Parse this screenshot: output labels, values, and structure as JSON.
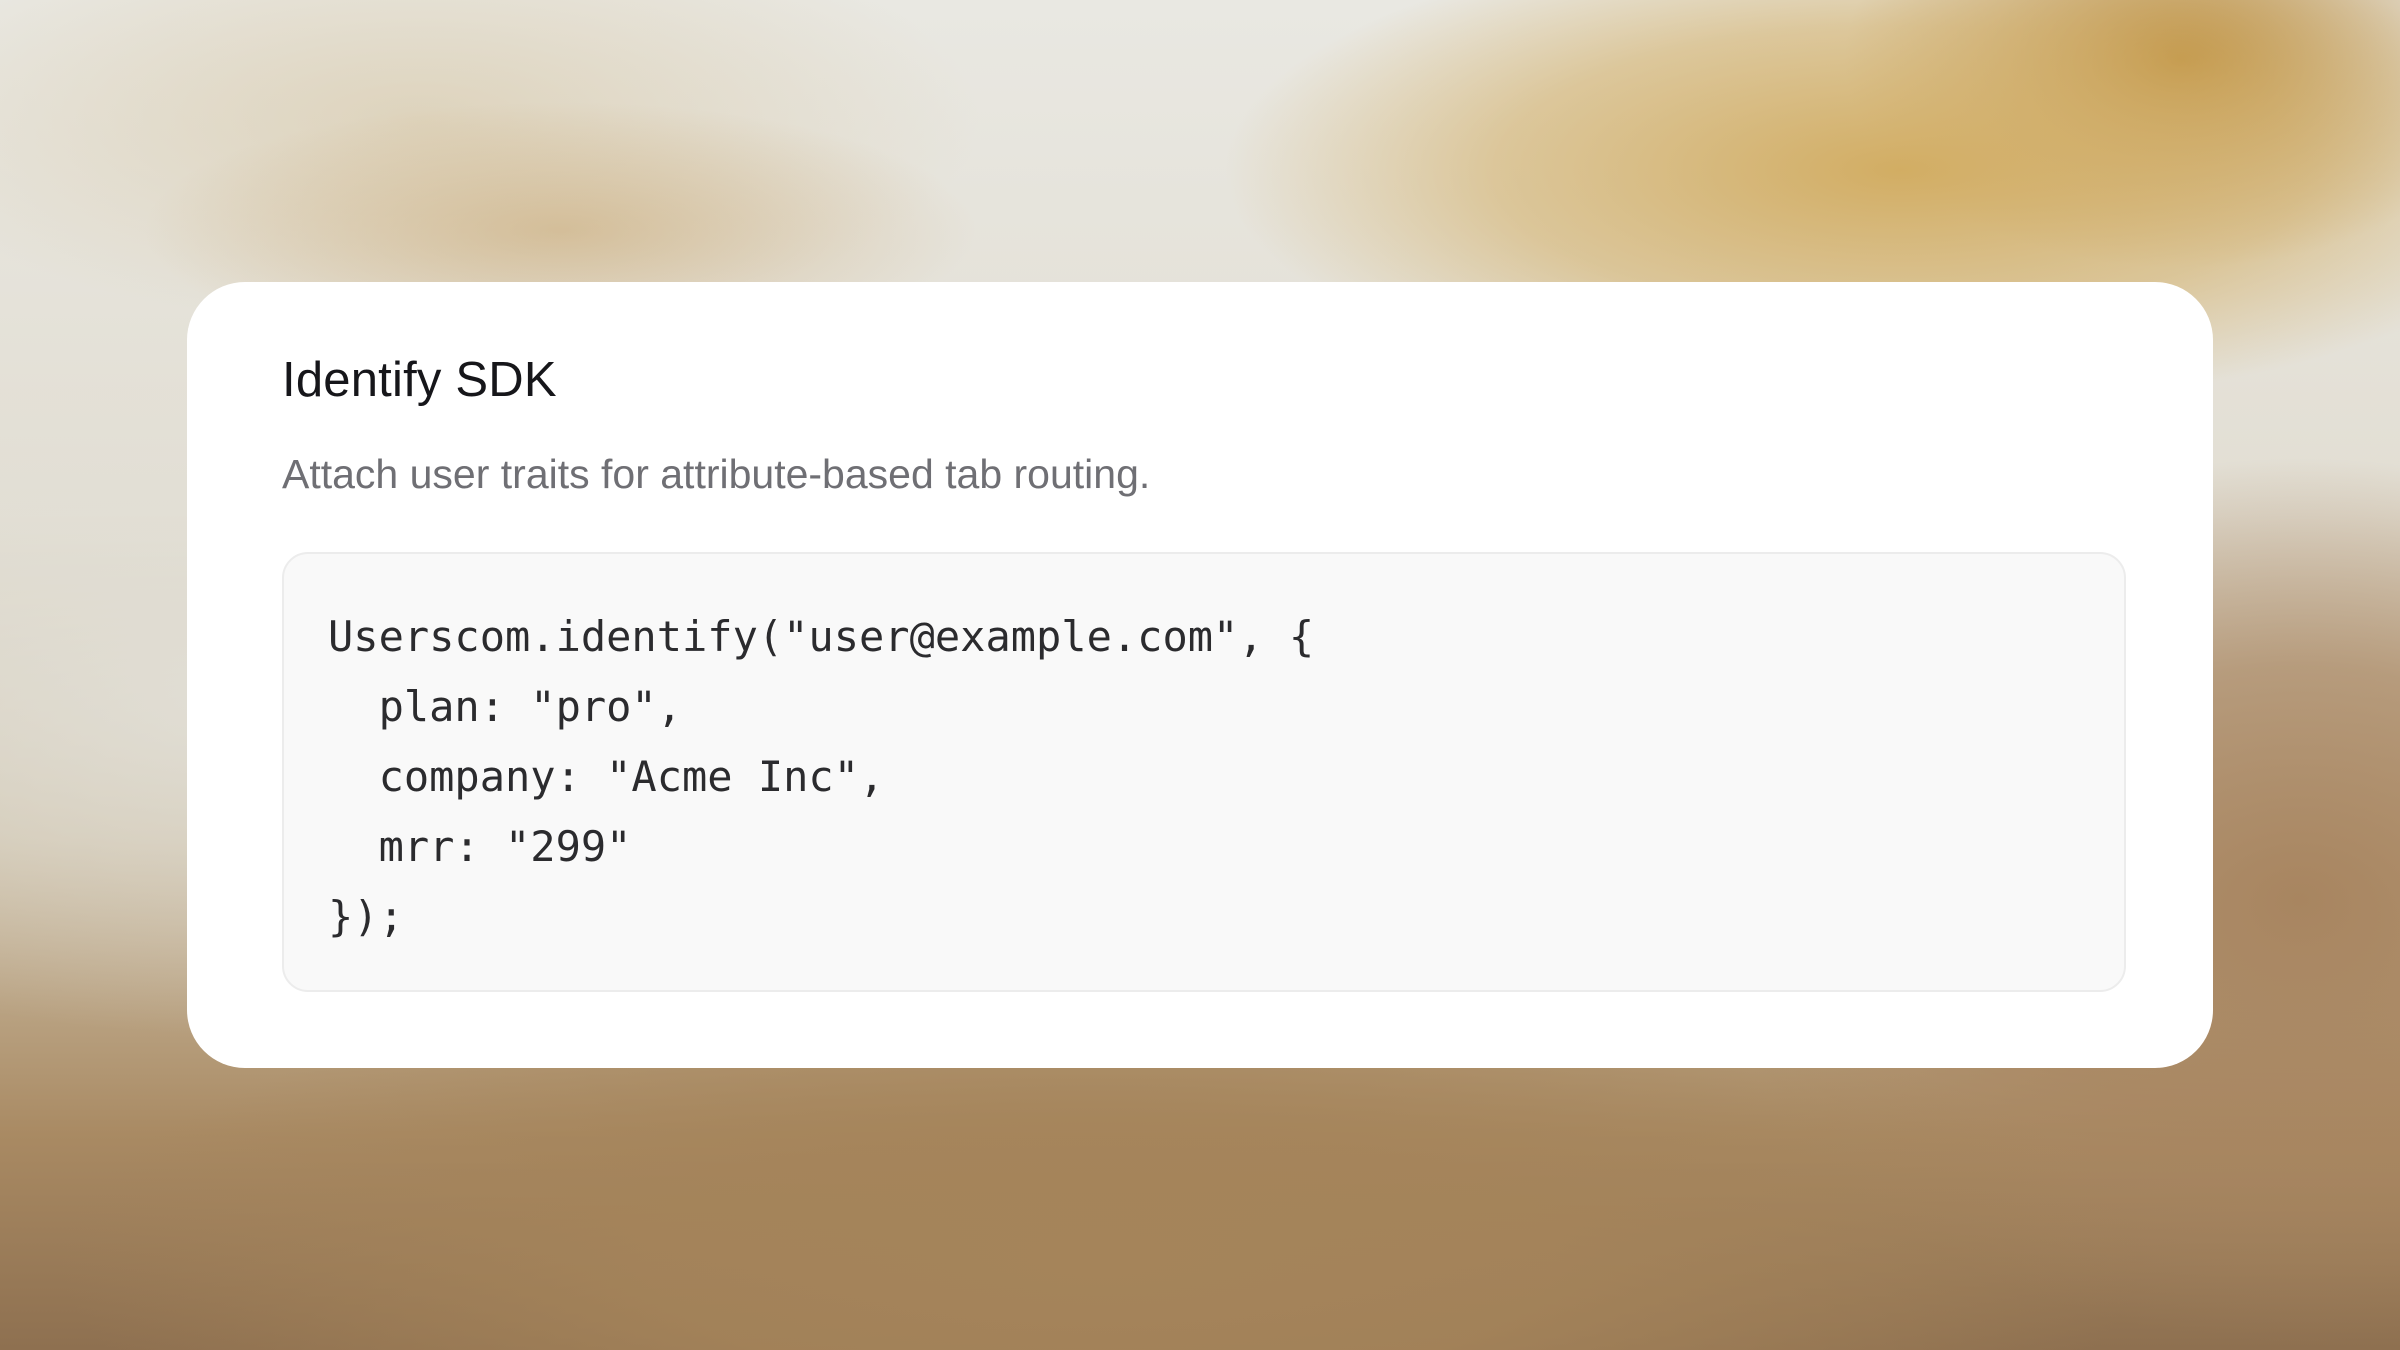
{
  "card": {
    "title": "Identify SDK",
    "subtitle": "Attach user traits for attribute-based tab routing."
  },
  "code": {
    "lines": [
      "Userscom.identify(\"user@example.com\", {",
      "  plan: \"pro\",",
      "  company: \"Acme Inc\",",
      "  mrr: \"299\"",
      "});"
    ]
  }
}
